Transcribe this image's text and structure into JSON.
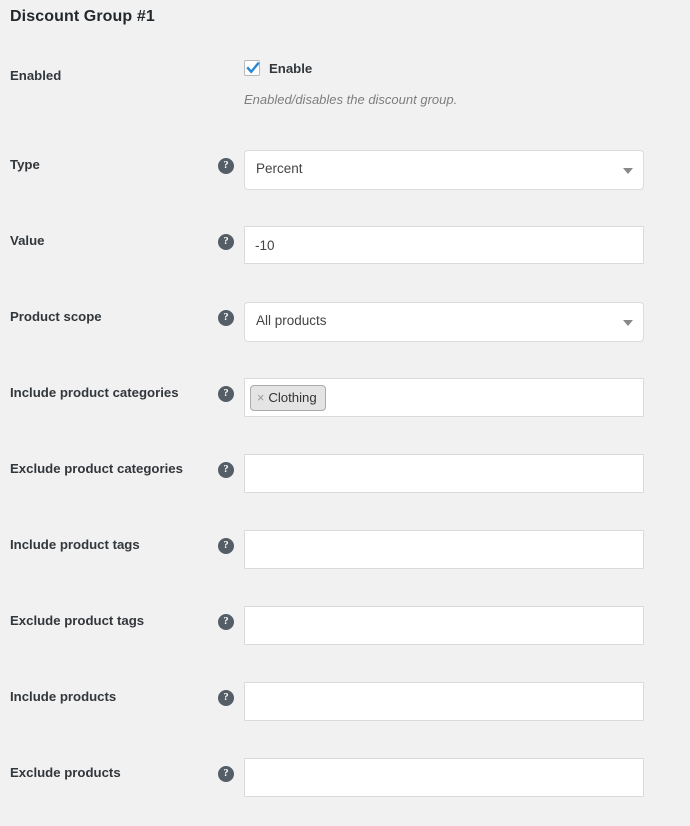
{
  "panel": {
    "title": "Discount Group #1"
  },
  "icons": {
    "help": "?",
    "token_remove": "×"
  },
  "rows": [
    {
      "label": "Enabled",
      "type": "checkbox",
      "checkbox_label": "Enable",
      "checked": true,
      "description": "Enabled/disables the discount group.",
      "has_help": false
    },
    {
      "label": "Type",
      "type": "select",
      "value": "Percent",
      "has_help": true
    },
    {
      "label": "Value",
      "type": "text",
      "value": "-10",
      "placeholder": "",
      "has_help": true
    },
    {
      "label": "Product scope",
      "type": "select",
      "value": "All products",
      "has_help": true
    },
    {
      "label": "Include product categories",
      "type": "multiselect",
      "tokens": [
        "Clothing"
      ],
      "has_help": true
    },
    {
      "label": "Exclude product categories",
      "type": "multiselect",
      "tokens": [],
      "has_help": true
    },
    {
      "label": "Include product tags",
      "type": "multiselect",
      "tokens": [],
      "has_help": true
    },
    {
      "label": "Exclude product tags",
      "type": "multiselect",
      "tokens": [],
      "has_help": true
    },
    {
      "label": "Include products",
      "type": "multiselect",
      "tokens": [],
      "has_help": true
    },
    {
      "label": "Exclude products",
      "type": "multiselect",
      "tokens": [],
      "has_help": true
    }
  ],
  "colors": {
    "background": "#f1f1f1",
    "checkbox_check": "#2b87d4",
    "help_icon": "#555d66",
    "field_border": "#dadada",
    "token_background": "#e4e4e4"
  }
}
